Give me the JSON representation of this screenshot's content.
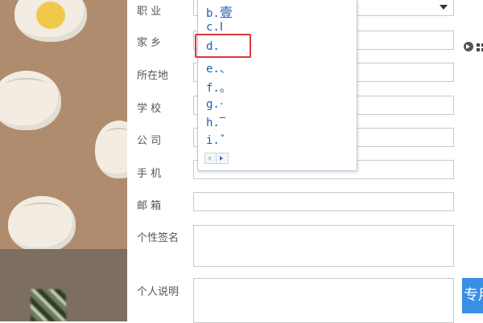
{
  "form": {
    "labels": {
      "occupation": "职 业",
      "hometown": "家 乡",
      "location": "所在地",
      "school": "学 校",
      "company": "公 司",
      "phone": "手 机",
      "email": "邮 箱",
      "signature": "个性签名",
      "bio": "个人说明"
    },
    "values": {
      "hometown": "",
      "location": "",
      "school": "",
      "company": "",
      "phone": "",
      "email": "",
      "signature": "",
      "bio": ""
    }
  },
  "candidates": {
    "items": [
      {
        "key": "b.",
        "symbol": "壹"
      },
      {
        "key": "c.",
        "symbol": "I"
      },
      {
        "key": "d.",
        "symbol": ""
      },
      {
        "key": "e.",
        "symbol": "、"
      },
      {
        "key": "f.",
        "symbol": "。"
      },
      {
        "key": "g.",
        "symbol": "·"
      },
      {
        "key": "h.",
        "symbol": "‾"
      },
      {
        "key": "i.",
        "symbol": "ˇ"
      }
    ],
    "highlighted_index": 2
  },
  "right_button": {
    "label": "专用"
  },
  "colors": {
    "wallpaper": "#b08c6e",
    "candidate_text": "#1e5fa8",
    "highlight_border": "#d9383a",
    "accent_button": "#3a8ee6",
    "field_border": "#c9c9c9"
  },
  "icons": [
    "dumpling-decoration-icon",
    "yolk-decoration-icon",
    "play-circle-icon",
    "grid-icon",
    "chevron-down-icon",
    "page-prev-icon",
    "page-next-icon"
  ]
}
